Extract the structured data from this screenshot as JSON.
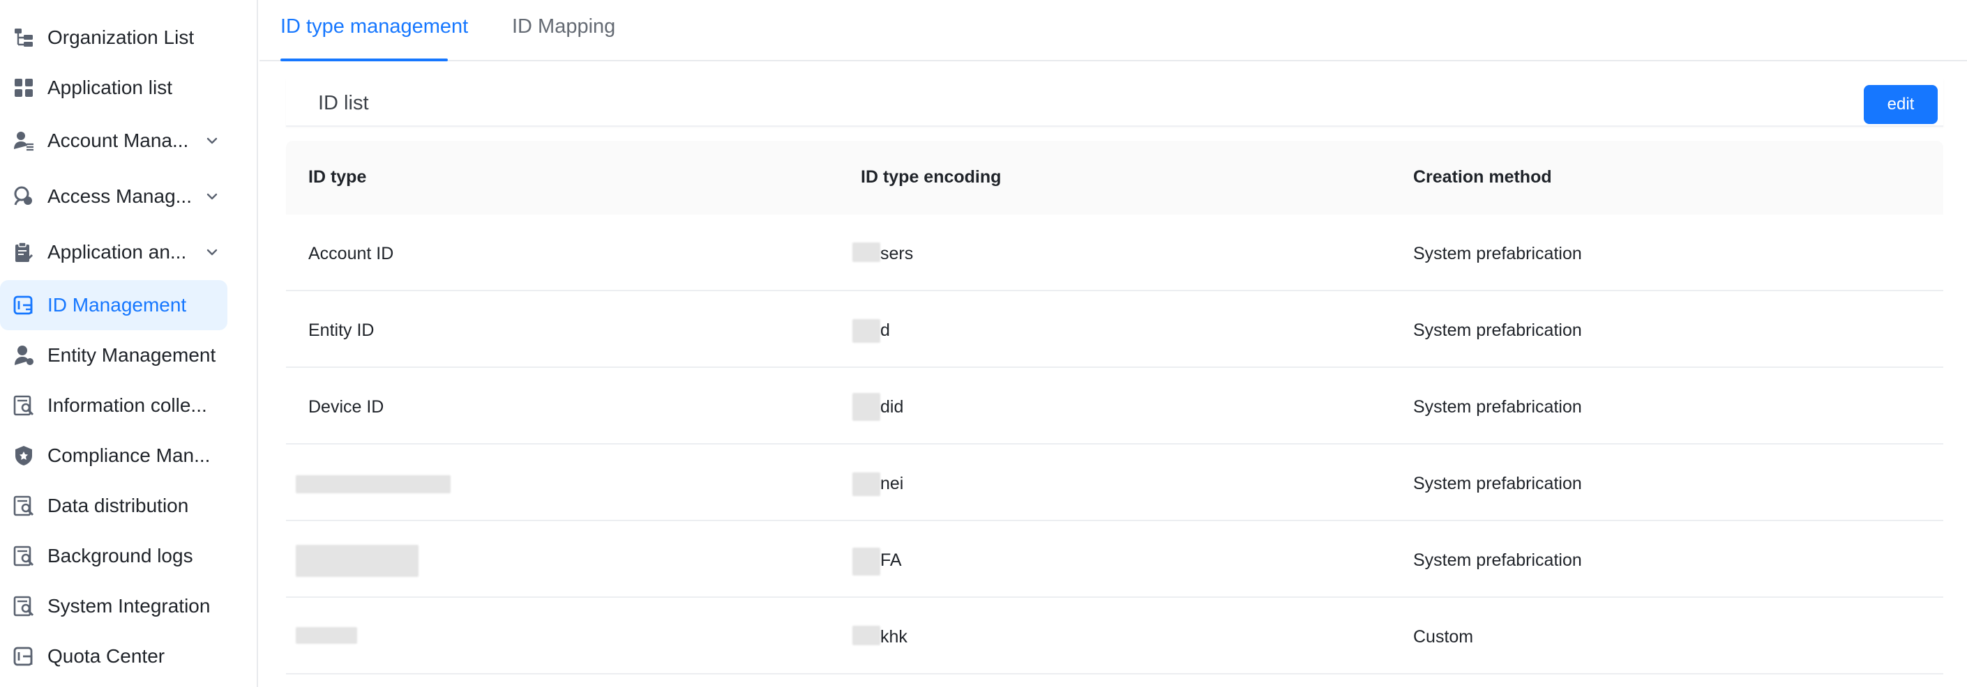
{
  "sidebar": {
    "items": [
      {
        "label": "Organization List",
        "icon": "org-tree-icon",
        "expandable": false,
        "active": false
      },
      {
        "label": "Application list",
        "icon": "grid-apps-icon",
        "expandable": false,
        "active": false
      },
      {
        "label": "Account Mana...",
        "icon": "user-list-icon",
        "expandable": true,
        "active": false
      },
      {
        "label": "Access Manag...",
        "icon": "access-key-icon",
        "expandable": true,
        "active": false
      },
      {
        "label": "Application an...",
        "icon": "clipboard-check-icon",
        "expandable": true,
        "active": false
      },
      {
        "label": "ID Management",
        "icon": "id-card-icon",
        "expandable": false,
        "active": true
      },
      {
        "label": "Entity Management",
        "icon": "entity-user-icon",
        "expandable": false,
        "active": false
      },
      {
        "label": "Information colle...",
        "icon": "doc-search-icon",
        "expandable": false,
        "active": false
      },
      {
        "label": "Compliance Man...",
        "icon": "shield-icon",
        "expandable": false,
        "active": false
      },
      {
        "label": "Data distribution",
        "icon": "doc-search-icon",
        "expandable": false,
        "active": false
      },
      {
        "label": "Background logs",
        "icon": "doc-search-icon",
        "expandable": false,
        "active": false
      },
      {
        "label": "System Integration",
        "icon": "doc-search-icon",
        "expandable": false,
        "active": false
      },
      {
        "label": "Quota Center",
        "icon": "quota-icon",
        "expandable": false,
        "active": false
      }
    ]
  },
  "tabs": [
    {
      "label": "ID type management",
      "active": true
    },
    {
      "label": "ID Mapping",
      "active": false
    }
  ],
  "card": {
    "title": "ID list",
    "edit_label": "edit"
  },
  "table": {
    "headers": [
      "ID type",
      "ID type encoding",
      "Creation method"
    ],
    "rows": [
      [
        "Account ID",
        "sers",
        "System prefabrication"
      ],
      [
        "Entity ID",
        "d",
        "System prefabrication"
      ],
      [
        "Device ID",
        "did",
        "System prefabrication"
      ],
      [
        "",
        "nei",
        "System prefabrication"
      ],
      [
        "",
        "FA",
        "System prefabrication"
      ],
      [
        "",
        "khk",
        "Custom"
      ]
    ]
  },
  "colors": {
    "accent": "#1677ff",
    "active_bg": "#e8f3ff",
    "text": "#1f2329",
    "muted": "#646a73"
  }
}
